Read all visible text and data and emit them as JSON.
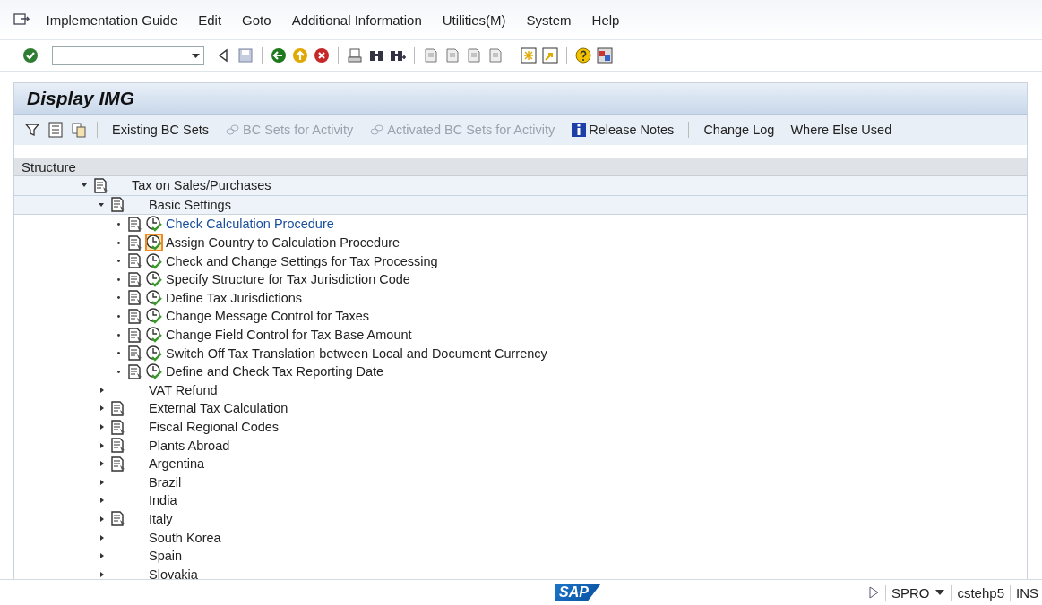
{
  "menu_bar": {
    "items": [
      "Implementation Guide",
      "Edit",
      "Goto",
      "Additional Information",
      "Utilities(M)",
      "System",
      "Help"
    ]
  },
  "title": "Display IMG",
  "app_toolbar": {
    "items": [
      {
        "kind": "text",
        "label": "Existing BC Sets",
        "disabled": false
      },
      {
        "kind": "bcset",
        "label": "BC Sets for Activity",
        "disabled": true
      },
      {
        "kind": "bcset",
        "label": "Activated BC Sets for Activity",
        "disabled": true
      },
      {
        "kind": "info",
        "label": "Release Notes",
        "disabled": false
      },
      {
        "kind": "text",
        "label": "Change Log",
        "disabled": false
      },
      {
        "kind": "text",
        "label": "Where Else Used",
        "disabled": false
      }
    ]
  },
  "structure": {
    "header": "Structure",
    "nodes": [
      {
        "kind": "folder",
        "label": "Tax on Sales/Purchases",
        "expanded": true,
        "doc": true,
        "selected": false,
        "children": [
          {
            "kind": "folder",
            "label": "Basic Settings",
            "expanded": true,
            "doc": true,
            "selected": false,
            "children": [
              {
                "kind": "activity",
                "label": "Check Calculation Procedure",
                "doc": true,
                "selected": true,
                "focused": false
              },
              {
                "kind": "activity",
                "label": "Assign Country to Calculation Procedure",
                "doc": true,
                "selected": false,
                "focused": true
              },
              {
                "kind": "activity",
                "label": "Check and Change Settings for Tax Processing",
                "doc": true,
                "selected": false,
                "focused": false
              },
              {
                "kind": "activity",
                "label": "Specify Structure for Tax Jurisdiction Code",
                "doc": true,
                "selected": false,
                "focused": false
              },
              {
                "kind": "activity",
                "label": "Define Tax Jurisdictions",
                "doc": true,
                "selected": false,
                "focused": false
              },
              {
                "kind": "activity",
                "label": "Change Message Control for Taxes",
                "doc": true,
                "selected": false,
                "focused": false
              },
              {
                "kind": "activity",
                "label": "Change Field Control for Tax Base Amount",
                "doc": true,
                "selected": false,
                "focused": false
              },
              {
                "kind": "activity",
                "label": "Switch Off Tax Translation between Local and Document Currency",
                "doc": true,
                "selected": false,
                "focused": false
              },
              {
                "kind": "activity",
                "label": "Define and Check Tax Reporting Date",
                "doc": true,
                "selected": false,
                "focused": false
              }
            ]
          },
          {
            "kind": "folder",
            "label": "VAT Refund",
            "expanded": false,
            "doc": false,
            "selected": false
          },
          {
            "kind": "folder",
            "label": "External Tax Calculation",
            "expanded": false,
            "doc": true,
            "selected": false
          },
          {
            "kind": "folder",
            "label": "Fiscal Regional Codes",
            "expanded": false,
            "doc": true,
            "selected": false
          },
          {
            "kind": "folder",
            "label": "Plants Abroad",
            "expanded": false,
            "doc": true,
            "selected": false
          },
          {
            "kind": "folder",
            "label": "Argentina",
            "expanded": false,
            "doc": true,
            "selected": false
          },
          {
            "kind": "folder",
            "label": "Brazil",
            "expanded": false,
            "doc": false,
            "selected": false
          },
          {
            "kind": "folder",
            "label": "India",
            "expanded": false,
            "doc": false,
            "selected": false
          },
          {
            "kind": "folder",
            "label": "Italy",
            "expanded": false,
            "doc": true,
            "selected": false
          },
          {
            "kind": "folder",
            "label": "South Korea",
            "expanded": false,
            "doc": false,
            "selected": false
          },
          {
            "kind": "folder",
            "label": "Spain",
            "expanded": false,
            "doc": false,
            "selected": false
          },
          {
            "kind": "folder",
            "label": "Slovakia",
            "expanded": false,
            "doc": false,
            "selected": false
          }
        ]
      }
    ]
  },
  "status_bar": {
    "logo": "SAP",
    "transaction": "SPRO",
    "system": "cstehp5",
    "mode": "INS"
  }
}
